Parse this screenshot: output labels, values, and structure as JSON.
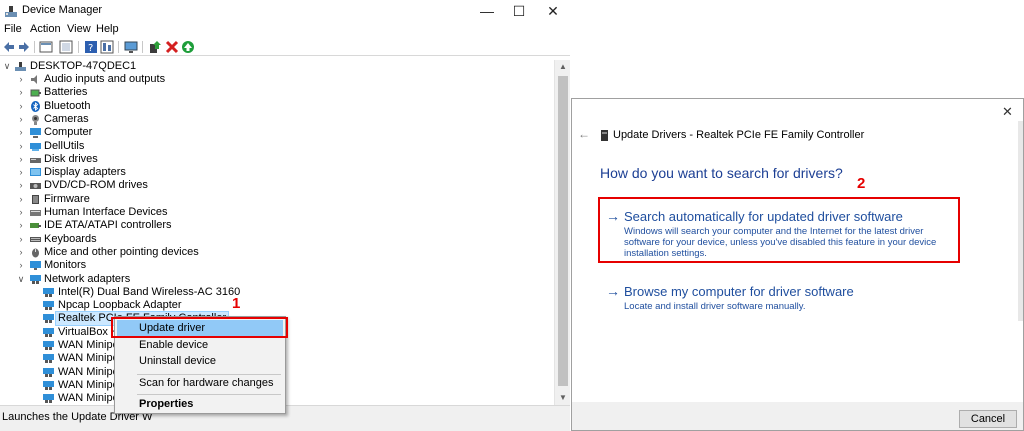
{
  "device_manager": {
    "title": "Device Manager",
    "menu": [
      "File",
      "Action",
      "View",
      "Help"
    ],
    "window_buttons": {
      "minimize": "—",
      "maximize": "☐",
      "close": "✕"
    },
    "root": "DESKTOP-47QDEC1",
    "categories": [
      "Audio inputs and outputs",
      "Batteries",
      "Bluetooth",
      "Cameras",
      "Computer",
      "DellUtils",
      "Disk drives",
      "Display adapters",
      "DVD/CD-ROM drives",
      "Firmware",
      "Human Interface Devices",
      "IDE ATA/ATAPI controllers",
      "Keyboards",
      "Mice and other pointing devices",
      "Monitors",
      "Network adapters"
    ],
    "network_adapters": [
      "Intel(R) Dual Band Wireless-AC 3160",
      "Npcap Loopback Adapter",
      "Realtek PCIe FE Family Controller",
      "VirtualBox Hos",
      "WAN Miniport",
      "WAN Miniport",
      "WAN Miniport",
      "WAN Miniport",
      "WAN Miniport"
    ],
    "status_text": "Launches the Update Driver W",
    "context_menu": {
      "update": "Update driver",
      "enable": "Enable device",
      "uninstall": "Uninstall device",
      "scan": "Scan for hardware changes",
      "properties": "Properties"
    },
    "step_label": "1"
  },
  "update_dialog": {
    "close": "✕",
    "back": "←",
    "header": "Update Drivers - Realtek PCIe FE Family Controller",
    "question": "How do you want to search for drivers?",
    "step_label": "2",
    "option_auto": {
      "arrow": "→",
      "title": "Search automatically for updated driver software",
      "description": "Windows will search your computer and the Internet for the latest driver software for your device, unless you've disabled this feature in your device installation settings."
    },
    "option_browse": {
      "arrow": "→",
      "title": "Browse my computer for driver software",
      "description": "Locate and install driver software manually."
    },
    "cancel": "Cancel"
  },
  "colors": {
    "accent_link": "#1f4e9e",
    "highlight_red": "#e60000",
    "menu_highlight": "#91c9f7"
  }
}
